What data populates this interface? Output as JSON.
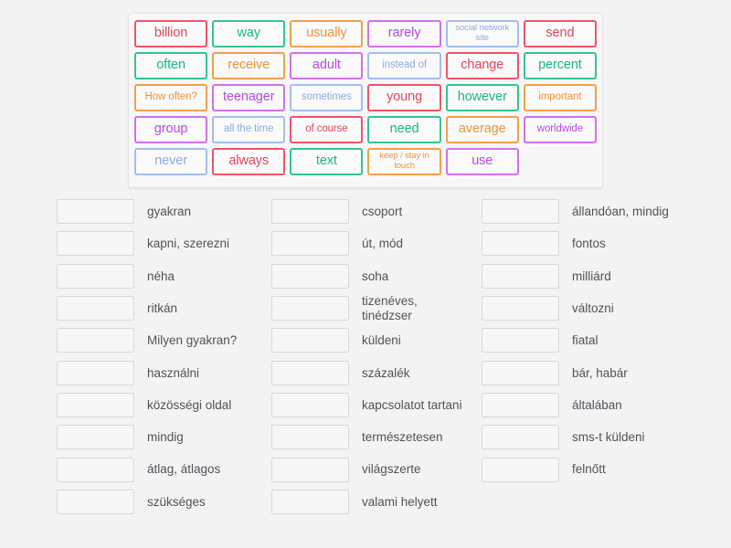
{
  "word_bank": {
    "name": "word-bank",
    "colors": {
      "red": "#ed5569",
      "green": "#35c48f",
      "orange": "#f0a04b",
      "purple": "#d071e8",
      "blue": "#a3bdec"
    },
    "tiles": [
      {
        "label": "billion",
        "color": "red",
        "size": "normal"
      },
      {
        "label": "way",
        "color": "green",
        "size": "normal"
      },
      {
        "label": "usually",
        "color": "orange",
        "size": "normal"
      },
      {
        "label": "rarely",
        "color": "purple",
        "size": "normal"
      },
      {
        "label": "social\nnetwork site",
        "color": "blue",
        "size": "small"
      },
      {
        "label": "send",
        "color": "red",
        "size": "normal"
      },
      {
        "label": "often",
        "color": "green",
        "size": "normal"
      },
      {
        "label": "receive",
        "color": "orange",
        "size": "normal"
      },
      {
        "label": "adult",
        "color": "purple",
        "size": "normal"
      },
      {
        "label": "instead of",
        "color": "blue",
        "size": "med"
      },
      {
        "label": "change",
        "color": "red",
        "size": "normal"
      },
      {
        "label": "percent",
        "color": "green",
        "size": "normal"
      },
      {
        "label": "How often?",
        "color": "orange",
        "size": "med"
      },
      {
        "label": "teenager",
        "color": "purple",
        "size": "normal"
      },
      {
        "label": "sometimes",
        "color": "blue",
        "size": "med"
      },
      {
        "label": "young",
        "color": "red",
        "size": "normal"
      },
      {
        "label": "however",
        "color": "green",
        "size": "normal"
      },
      {
        "label": "important",
        "color": "orange",
        "size": "med"
      },
      {
        "label": "group",
        "color": "purple",
        "size": "normal"
      },
      {
        "label": "all the time",
        "color": "blue",
        "size": "med"
      },
      {
        "label": "of course",
        "color": "red",
        "size": "med"
      },
      {
        "label": "need",
        "color": "green",
        "size": "normal"
      },
      {
        "label": "average",
        "color": "orange",
        "size": "normal"
      },
      {
        "label": "worldwide",
        "color": "purple",
        "size": "med"
      },
      {
        "label": "never",
        "color": "blue",
        "size": "normal"
      },
      {
        "label": "always",
        "color": "red",
        "size": "normal"
      },
      {
        "label": "text",
        "color": "green",
        "size": "normal"
      },
      {
        "label": "keep / stay\nin touch",
        "color": "orange",
        "size": "small"
      },
      {
        "label": "use",
        "color": "purple",
        "size": "normal"
      },
      {
        "label": "",
        "color": "empty",
        "size": "normal"
      }
    ]
  },
  "answers": {
    "columns": [
      {
        "name": "answer-column-1",
        "rows": [
          {
            "slot_value": "",
            "label": "gyakran"
          },
          {
            "slot_value": "",
            "label": "kapni, szerezni"
          },
          {
            "slot_value": "",
            "label": "néha"
          },
          {
            "slot_value": "",
            "label": "ritkán"
          },
          {
            "slot_value": "",
            "label": "Milyen gyakran?"
          },
          {
            "slot_value": "",
            "label": "használni"
          },
          {
            "slot_value": "",
            "label": "közösségi oldal"
          },
          {
            "slot_value": "",
            "label": "mindig"
          },
          {
            "slot_value": "",
            "label": "átlag, átlagos"
          },
          {
            "slot_value": "",
            "label": "szükséges"
          }
        ]
      },
      {
        "name": "answer-column-2",
        "rows": [
          {
            "slot_value": "",
            "label": "csoport"
          },
          {
            "slot_value": "",
            "label": "út, mód"
          },
          {
            "slot_value": "",
            "label": "soha"
          },
          {
            "slot_value": "",
            "label": "tizenéves,\ntinédzser"
          },
          {
            "slot_value": "",
            "label": "küldeni"
          },
          {
            "slot_value": "",
            "label": "százalék"
          },
          {
            "slot_value": "",
            "label": "kapcsolatot tartani"
          },
          {
            "slot_value": "",
            "label": "természetesen"
          },
          {
            "slot_value": "",
            "label": "világszerte"
          },
          {
            "slot_value": "",
            "label": "valami helyett"
          }
        ]
      },
      {
        "name": "answer-column-3",
        "rows": [
          {
            "slot_value": "",
            "label": "állandóan, mindig"
          },
          {
            "slot_value": "",
            "label": "fontos"
          },
          {
            "slot_value": "",
            "label": "milliárd"
          },
          {
            "slot_value": "",
            "label": "változni"
          },
          {
            "slot_value": "",
            "label": "fiatal"
          },
          {
            "slot_value": "",
            "label": "bár, habár"
          },
          {
            "slot_value": "",
            "label": "általában"
          },
          {
            "slot_value": "",
            "label": "sms-t küldeni"
          },
          {
            "slot_value": "",
            "label": "felnőtt"
          }
        ]
      }
    ]
  }
}
